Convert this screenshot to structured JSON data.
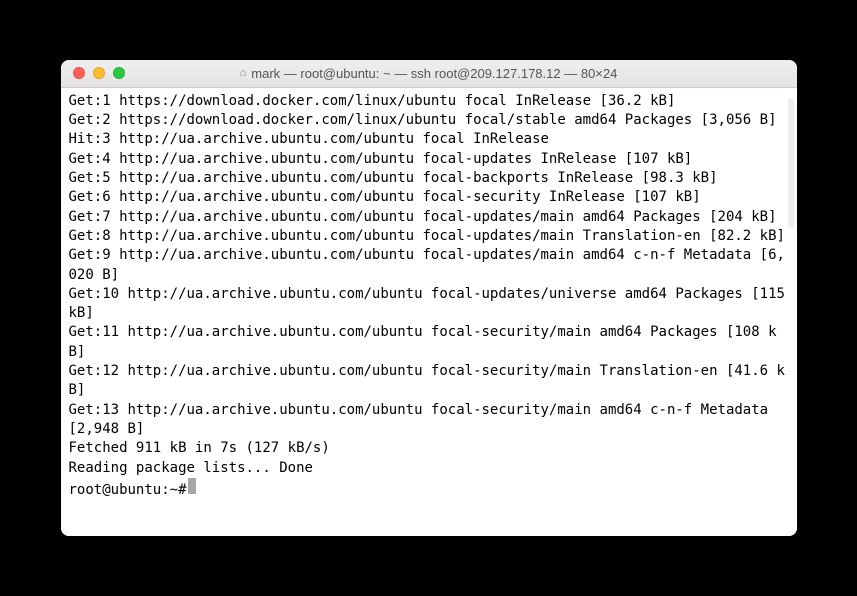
{
  "window": {
    "title": "mark — root@ubuntu: ~ — ssh root@209.127.178.12 — 80×24"
  },
  "output": {
    "lines": [
      "Get:1 https://download.docker.com/linux/ubuntu focal InRelease [36.2 kB]",
      "Get:2 https://download.docker.com/linux/ubuntu focal/stable amd64 Packages [3,056 B]",
      "Hit:3 http://ua.archive.ubuntu.com/ubuntu focal InRelease",
      "Get:4 http://ua.archive.ubuntu.com/ubuntu focal-updates InRelease [107 kB]",
      "Get:5 http://ua.archive.ubuntu.com/ubuntu focal-backports InRelease [98.3 kB]",
      "Get:6 http://ua.archive.ubuntu.com/ubuntu focal-security InRelease [107 kB]",
      "Get:7 http://ua.archive.ubuntu.com/ubuntu focal-updates/main amd64 Packages [204 kB]",
      "Get:8 http://ua.archive.ubuntu.com/ubuntu focal-updates/main Translation-en [82.2 kB]",
      "Get:9 http://ua.archive.ubuntu.com/ubuntu focal-updates/main amd64 c-n-f Metadata [6,020 B]",
      "Get:10 http://ua.archive.ubuntu.com/ubuntu focal-updates/universe amd64 Packages [115 kB]",
      "Get:11 http://ua.archive.ubuntu.com/ubuntu focal-security/main amd64 Packages [108 kB]",
      "Get:12 http://ua.archive.ubuntu.com/ubuntu focal-security/main Translation-en [41.6 kB]",
      "Get:13 http://ua.archive.ubuntu.com/ubuntu focal-security/main amd64 c-n-f Metadata [2,948 B]",
      "Fetched 911 kB in 7s (127 kB/s)",
      "Reading package lists... Done"
    ],
    "prompt": "root@ubuntu:~# "
  }
}
